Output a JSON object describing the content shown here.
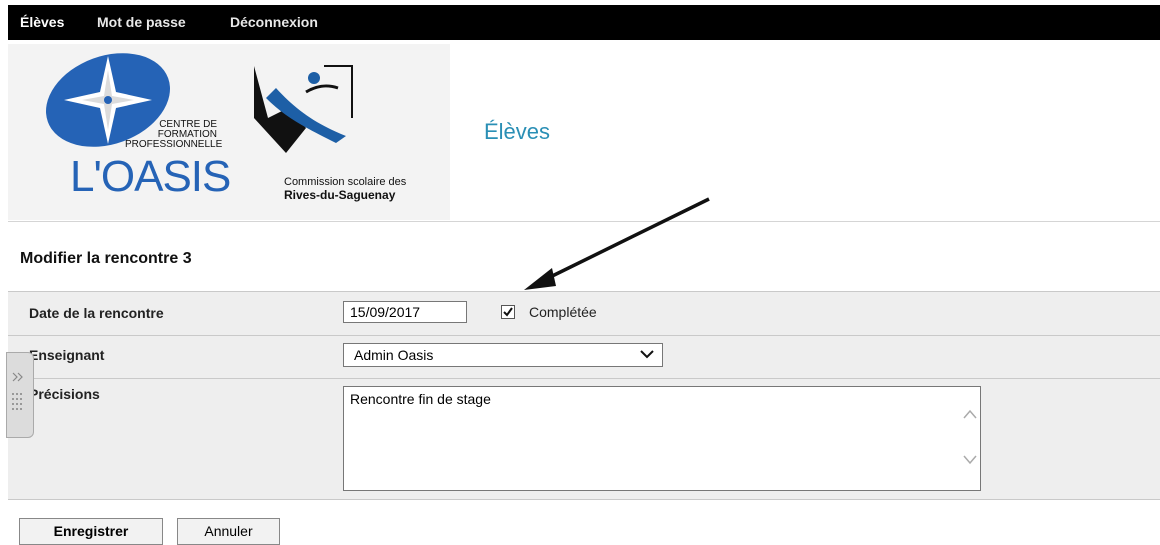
{
  "topnav": {
    "items": [
      "Élèves",
      "Mot de passe",
      "Déconnexion"
    ]
  },
  "header": {
    "oasis_logo": {
      "line1": "CENTRE DE",
      "line2": "FORMATION",
      "line3": "PROFESSIONNELLE",
      "name": "L'OASIS"
    },
    "cs_logo": {
      "line1": "Commission scolaire des",
      "line2": "Rives-du-Saguenay"
    },
    "page_title": "Élèves"
  },
  "section": {
    "title": "Modifier la rencontre 3"
  },
  "form": {
    "date_label": "Date de la rencontre",
    "date_value": "15/09/2017",
    "completed_label": "Complétée",
    "completed_checked": true,
    "teacher_label": "Enseignant",
    "teacher_value": "Admin Oasis",
    "details_label": "Précisions",
    "details_value": "Rencontre fin de stage"
  },
  "buttons": {
    "save": "Enregistrer",
    "cancel": "Annuler"
  },
  "colors": {
    "heading_accent": "#2a8fb5",
    "logo_blue": "#2563b6",
    "nav_bg": "#000000"
  }
}
